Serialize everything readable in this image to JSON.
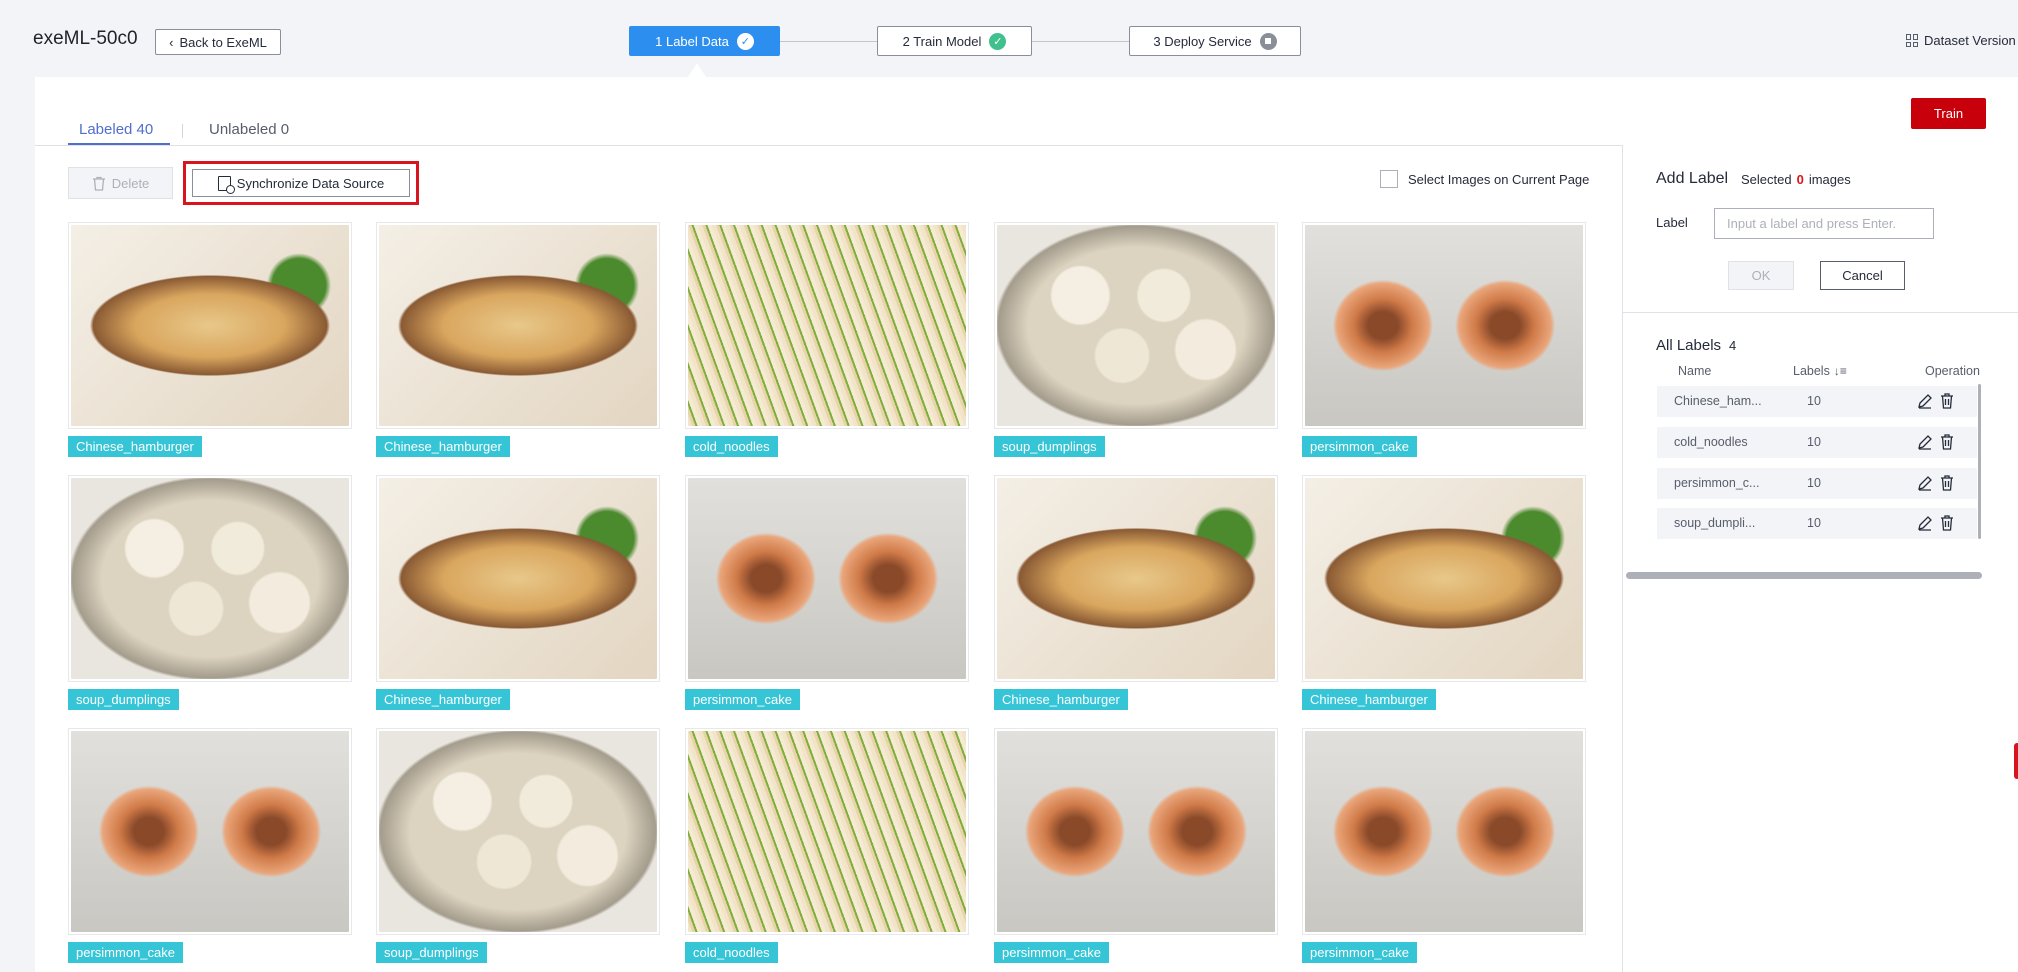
{
  "header": {
    "app_title": "exeML-50c0",
    "back_label": "Back to ExeML",
    "steps": [
      {
        "label": "1 Label Data",
        "status": "active"
      },
      {
        "label": "2 Train Model",
        "status": "done"
      },
      {
        "label": "3 Deploy Service",
        "status": "stopped"
      }
    ],
    "dataset_version_label": "Dataset Version"
  },
  "toolbar": {
    "train_label": "Train",
    "tabs": [
      {
        "label": "Labeled 40",
        "selected": true
      },
      {
        "label": "Unlabeled 0",
        "selected": false
      }
    ],
    "delete_label": "Delete",
    "sync_label": "Synchronize Data Source",
    "select_page_label": "Select Images on Current Page"
  },
  "images": [
    {
      "label": "Chinese_hamburger",
      "icon": "chinese-hamburger-photo"
    },
    {
      "label": "Chinese_hamburger",
      "icon": "chinese-hamburger-photo"
    },
    {
      "label": "cold_noodles",
      "icon": "cold-noodles-photo"
    },
    {
      "label": "soup_dumplings",
      "icon": "soup-dumplings-photo"
    },
    {
      "label": "persimmon_cake",
      "icon": "persimmon-cake-photo"
    },
    {
      "label": "soup_dumplings",
      "icon": "soup-dumplings-photo"
    },
    {
      "label": "Chinese_hamburger",
      "icon": "chinese-hamburger-photo"
    },
    {
      "label": "persimmon_cake",
      "icon": "persimmon-cake-photo"
    },
    {
      "label": "Chinese_hamburger",
      "icon": "chinese-hamburger-photo"
    },
    {
      "label": "Chinese_hamburger",
      "icon": "chinese-hamburger-photo"
    },
    {
      "label": "persimmon_cake",
      "icon": "persimmon-cake-photo"
    },
    {
      "label": "soup_dumplings",
      "icon": "soup-dumplings-photo"
    },
    {
      "label": "cold_noodles",
      "icon": "cold-noodles-photo"
    },
    {
      "label": "persimmon_cake",
      "icon": "persimmon-cake-photo"
    },
    {
      "label": "persimmon_cake",
      "icon": "persimmon-cake-photo"
    }
  ],
  "add_label": {
    "title": "Add Label",
    "selected_prefix": "Selected",
    "selected_count": "0",
    "selected_suffix": "images",
    "field_label": "Label",
    "placeholder": "Input a label and press Enter.",
    "ok_label": "OK",
    "cancel_label": "Cancel"
  },
  "all_labels": {
    "title": "All Labels",
    "count": "4",
    "columns": {
      "name": "Name",
      "labels": "Labels",
      "operation": "Operation"
    },
    "rows": [
      {
        "name": "Chinese_ham...",
        "count": "10"
      },
      {
        "name": "cold_noodles",
        "count": "10"
      },
      {
        "name": "persimmon_c...",
        "count": "10"
      },
      {
        "name": "soup_dumpli...",
        "count": "10"
      }
    ]
  },
  "colors": {
    "accent": "#2c8ff0",
    "tag": "#36c5d6",
    "train": "#c7000b",
    "highlight": "#d8141f"
  }
}
